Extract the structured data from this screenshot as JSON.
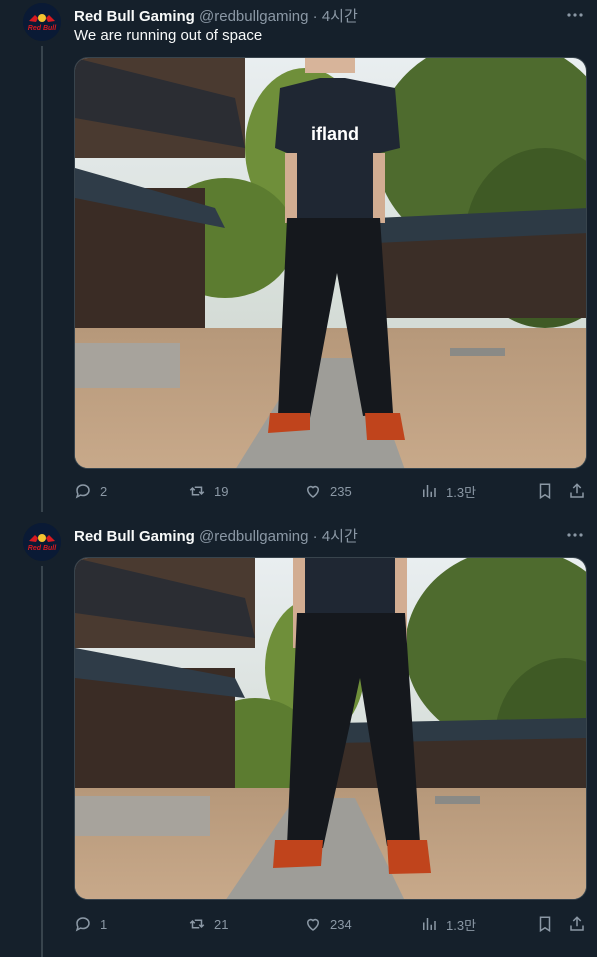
{
  "colors": {
    "background": "#15202b",
    "text_primary": "#f7f9f9",
    "text_secondary": "#8b98a5",
    "divider": "#38444d"
  },
  "tweets": [
    {
      "avatar_text": "Red Bull",
      "display_name": "Red Bull Gaming",
      "handle": "@redbullgaming",
      "separator": "·",
      "time": "4시간",
      "text": "We are running out of space",
      "media_description_icon": "photo",
      "shirt_text": "ifland",
      "actions": {
        "reply": "2",
        "retweet": "19",
        "like": "235",
        "views": "1.3만"
      }
    },
    {
      "avatar_text": "Red Bull",
      "display_name": "Red Bull Gaming",
      "handle": "@redbullgaming",
      "separator": "·",
      "time": "4시간",
      "text": "",
      "media_description_icon": "photo",
      "actions": {
        "reply": "1",
        "retweet": "21",
        "like": "234",
        "views": "1.3만"
      }
    }
  ]
}
